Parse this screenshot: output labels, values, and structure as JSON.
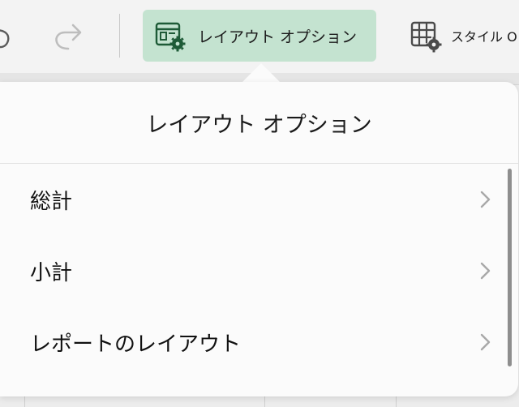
{
  "toolbar": {
    "undo_icon": "undo-icon",
    "redo_icon": "redo-icon",
    "layout_options_label": "レイアウト オプション",
    "layout_options_icon": "layout-options-gear-icon",
    "style_options_label": "スタイル O",
    "style_options_icon": "table-style-gear-icon",
    "accent_color": "#c4e3d0",
    "icon_color": "#1e5b37"
  },
  "popover": {
    "title": "レイアウト オプション",
    "items": [
      {
        "label": "総計"
      },
      {
        "label": "小計"
      },
      {
        "label": "レポートのレイアウト"
      }
    ]
  }
}
